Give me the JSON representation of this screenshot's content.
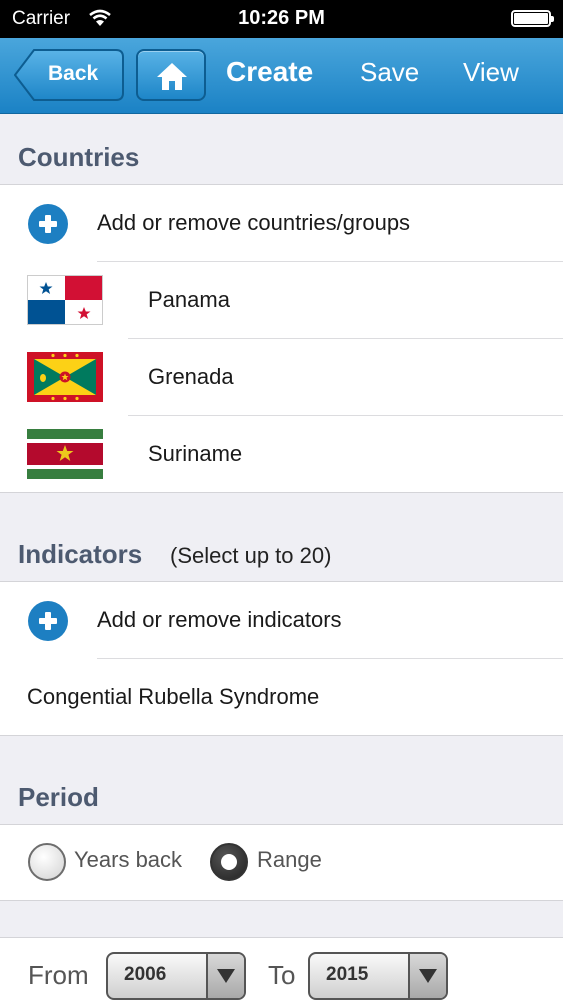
{
  "status_bar": {
    "carrier": "Carrier",
    "time": "10:26 PM"
  },
  "nav": {
    "back_label": "Back",
    "title": "Create",
    "save_label": "Save",
    "view_label": "View"
  },
  "countries": {
    "title": "Countries",
    "add_label": "Add or remove countries/groups",
    "items": [
      {
        "name": "Panama"
      },
      {
        "name": "Grenada"
      },
      {
        "name": "Suriname"
      }
    ]
  },
  "indicators": {
    "title": "Indicators",
    "subtitle": "(Select up to 20)",
    "add_label": "Add or remove indicators",
    "items": [
      {
        "name": "Congential Rubella Syndrome"
      }
    ]
  },
  "period": {
    "title": "Period",
    "options": [
      {
        "label": "Years back",
        "selected": false
      },
      {
        "label": "Range",
        "selected": true
      }
    ],
    "from_label": "From",
    "from_value": "2006",
    "to_label": "To",
    "to_value": "2015"
  },
  "colors": {
    "accent": "#1d7fc2",
    "nav_top": "#4aa6dc",
    "nav_bottom": "#1b82c5",
    "header_text": "#4d5a70"
  }
}
